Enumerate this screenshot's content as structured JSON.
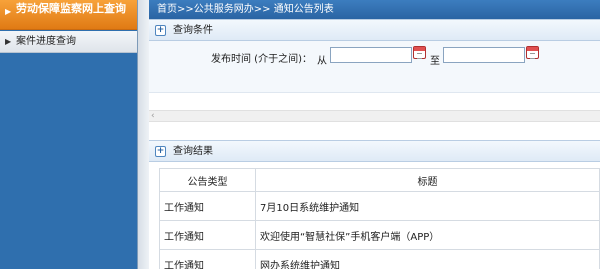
{
  "sidebar": {
    "header_label": "劳动保障监察网上查询",
    "items": [
      {
        "label": "案件进度查询"
      }
    ]
  },
  "breadcrumb": "首页>>公共服务网办>> 通知公告列表",
  "query_section": {
    "title": "查询条件",
    "date_label": "发布时间 (介于之间)：",
    "from_label": "从",
    "to_label": "至",
    "date_from_value": "",
    "date_to_value": ""
  },
  "result_section": {
    "title": "查询结果",
    "columns": [
      "公告类型",
      "标题"
    ],
    "rows": [
      {
        "type": "工作通知",
        "title": "7月10日系统维护通知"
      },
      {
        "type": "工作通知",
        "title": "欢迎使用“智慧社保”手机客户端（APP）"
      },
      {
        "type": "工作通知",
        "title": "网办系统维护通知"
      }
    ]
  },
  "colors": {
    "sidebar_bg": "#2f6fae",
    "sidebar_header": "#e88a22",
    "breadcrumb_bg": "#2f6aa8",
    "section_head_bg": "#e6eff8"
  },
  "icons": {
    "section_toggle": "plus-icon",
    "date_picker": "calendar-icon"
  }
}
